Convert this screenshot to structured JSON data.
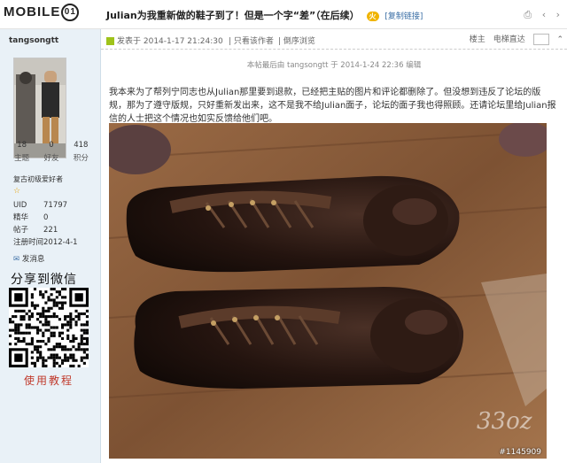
{
  "header": {
    "logo_text": "MOBILE",
    "logo_mark": "01",
    "thread_title": "Julian为我重新做的鞋子到了！但是一个字“差”（在后续）",
    "copy_link": "[复制链接]"
  },
  "sidebar": {
    "username": "tangsongtt",
    "stats": [
      {
        "value": "18",
        "label": "主题"
      },
      {
        "value": "0",
        "label": "好友"
      },
      {
        "value": "418",
        "label": "积分"
      }
    ],
    "rank": "复古初级爱好者",
    "profile": [
      {
        "key": "UID",
        "value": "71797"
      },
      {
        "key": "精华",
        "value": "0"
      },
      {
        "key": "帖子",
        "value": "221"
      },
      {
        "key": "注册时间",
        "value": "2012-4-1"
      }
    ],
    "message": "发消息",
    "share_title": "分享到微信",
    "usage_text": "使用教程"
  },
  "post": {
    "posted_at": "发表于 2014-1-17 21:24:30",
    "author_only": "只看该作者",
    "reverse": "倒序浏览",
    "floor": "楼主",
    "elevator": "电梯直达",
    "edited_note": "本帖最后由 tangsongtt 于 2014-1-24 22:36 编辑",
    "body": "我本来为了帮列宁同志也从Julian那里要到退款，已经把主贴的图片和评论都删除了。但没想到违反了论坛的版规，那为了遵守版规，只好重新发出来，这不是我不给Julian面子，论坛的面子我也得照顾。还请论坛里给Julian报信的人士把这个情况也如实反馈给他们吧。",
    "photo_watermark": "#1145909",
    "photo_site_mark": "33oz"
  }
}
